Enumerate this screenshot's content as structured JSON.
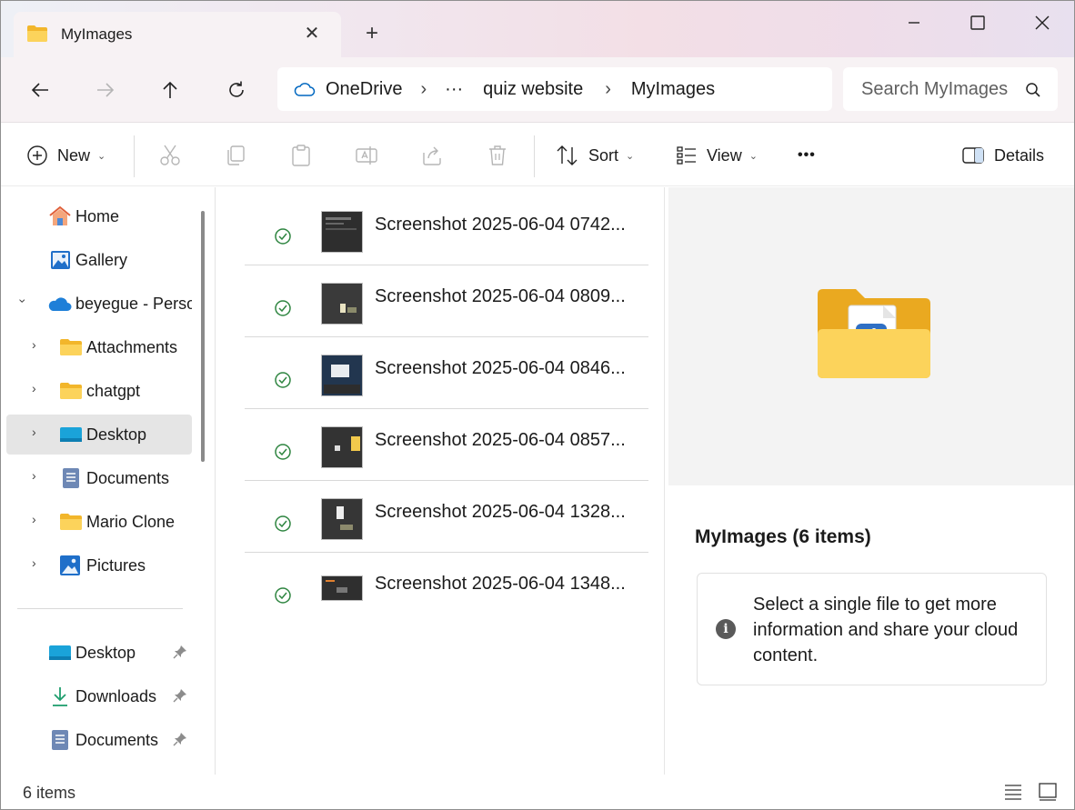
{
  "window": {
    "tab_title": "MyImages",
    "tab_close": "✕",
    "new_tab": "+"
  },
  "address": {
    "crumbs": [
      "OneDrive",
      "···",
      "quiz website",
      "MyImages"
    ],
    "separator": "›"
  },
  "search": {
    "placeholder": "Search MyImages"
  },
  "commands": {
    "new": "New",
    "sort": "Sort",
    "view": "View",
    "more": "•••",
    "details": "Details"
  },
  "sidebar": {
    "items": [
      {
        "label": "Home",
        "icon": "home-icon"
      },
      {
        "label": "Gallery",
        "icon": "gallery-icon"
      },
      {
        "label": "beyegue - Personal",
        "icon": "onedrive-cloud-icon",
        "expanded": true
      },
      {
        "label": "Attachments",
        "icon": "folder-icon"
      },
      {
        "label": "chatgpt",
        "icon": "folder-icon"
      },
      {
        "label": "Desktop",
        "icon": "desktop-icon",
        "selected": true
      },
      {
        "label": "Documents",
        "icon": "documents-icon"
      },
      {
        "label": "Mario Clone",
        "icon": "folder-icon"
      },
      {
        "label": "Pictures",
        "icon": "pictures-icon"
      }
    ],
    "quick_access": [
      {
        "label": "Desktop",
        "icon": "desktop-icon",
        "pinned": true
      },
      {
        "label": "Downloads",
        "icon": "download-icon",
        "pinned": true
      },
      {
        "label": "Documents",
        "icon": "documents-icon",
        "pinned": true
      }
    ]
  },
  "files": [
    {
      "name": "Screenshot 2025-06-04 0742...",
      "status": "synced"
    },
    {
      "name": "Screenshot 2025-06-04 0809...",
      "status": "synced"
    },
    {
      "name": "Screenshot 2025-06-04 0846...",
      "status": "synced"
    },
    {
      "name": "Screenshot 2025-06-04 0857...",
      "status": "synced"
    },
    {
      "name": "Screenshot 2025-06-04 1328...",
      "status": "synced"
    },
    {
      "name": "Screenshot 2025-06-04 1348...",
      "status": "synced"
    }
  ],
  "details_pane": {
    "title": "MyImages (6 items)",
    "info_icon": "i",
    "info_text": "Select a single file to get more information and share your cloud content."
  },
  "status": {
    "item_count": "6 items"
  },
  "colors": {
    "accent": "#0067c0",
    "sync_green": "#2e8540",
    "folder_yellow": "#f5c842"
  }
}
